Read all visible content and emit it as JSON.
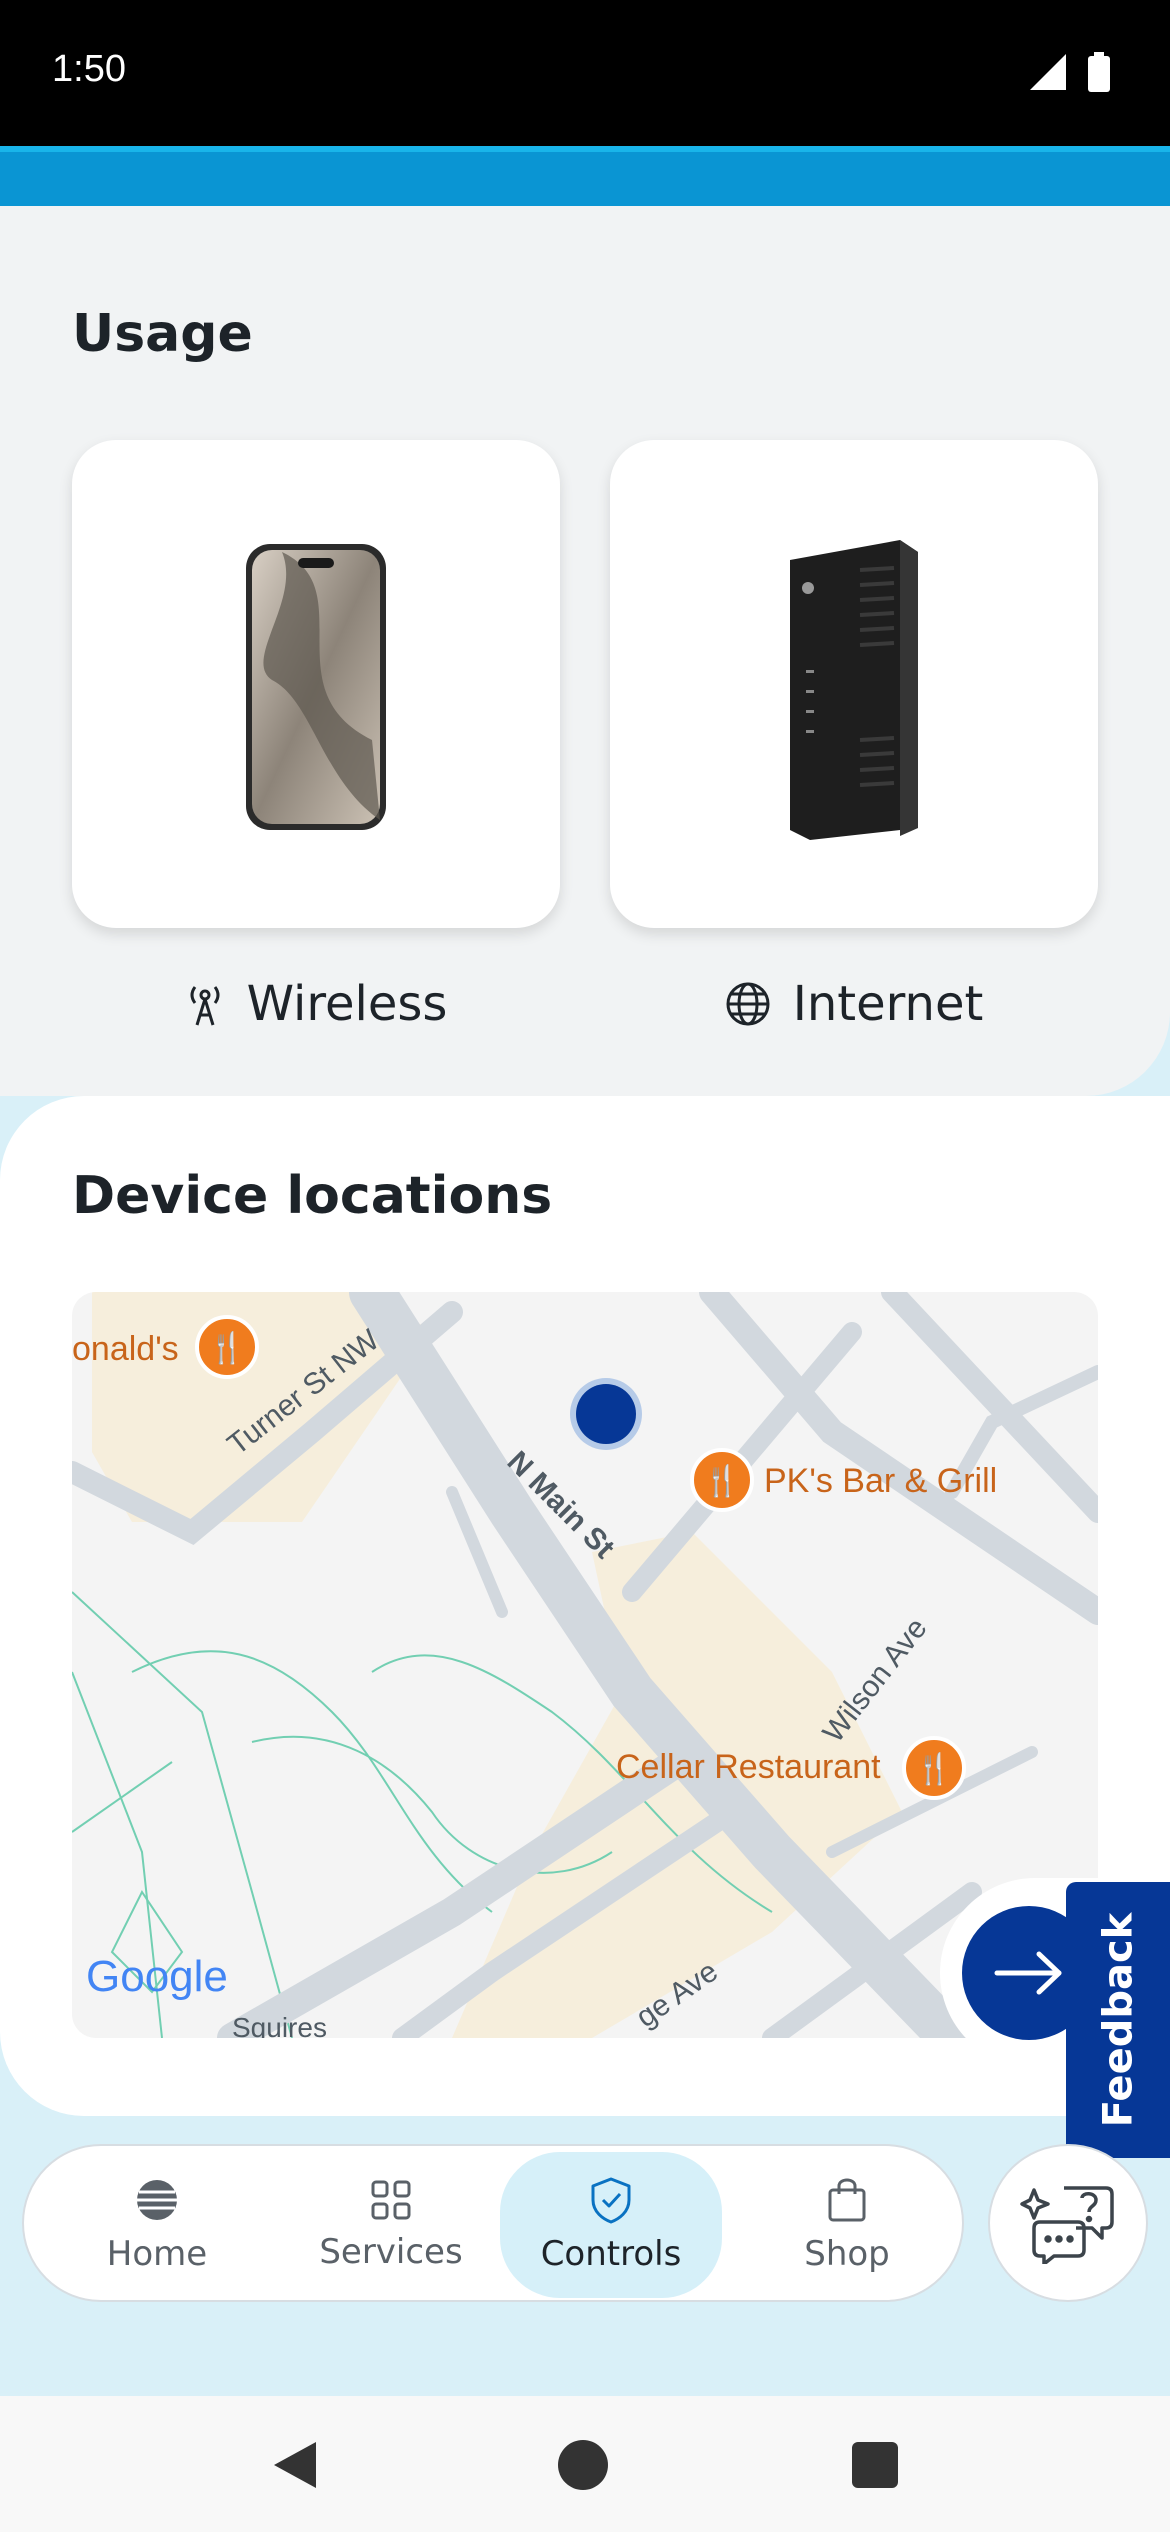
{
  "status": {
    "time": "1:50"
  },
  "usage": {
    "title": "Usage",
    "tiles": [
      {
        "label": "Wireless",
        "icon": "antenna-icon",
        "image": "phone-image"
      },
      {
        "label": "Internet",
        "icon": "globe-icon",
        "image": "router-image"
      }
    ]
  },
  "locations": {
    "title": "Device locations",
    "map": {
      "labels": {
        "mcdonalds": "onald's",
        "turner": "Turner St NW",
        "main": "N Main St",
        "pks": "PK's Bar & Grill",
        "wilson": "Wilson Ave",
        "cellar": "Cellar Restaurant",
        "squires": "Squires",
        "ridge": "ge Ave",
        "google": "Google"
      }
    }
  },
  "feedback": {
    "label": "Feedback"
  },
  "nav": {
    "items": [
      {
        "label": "Home",
        "icon": "att-globe-icon"
      },
      {
        "label": "Services",
        "icon": "grid-icon"
      },
      {
        "label": "Controls",
        "icon": "shield-check-icon",
        "active": true
      },
      {
        "label": "Shop",
        "icon": "shopping-bag-icon"
      }
    ]
  },
  "colors": {
    "accent": "#063796",
    "band": "#0a95d3",
    "active_nav": "#d6f0f9",
    "poi": "#f07c1e"
  }
}
